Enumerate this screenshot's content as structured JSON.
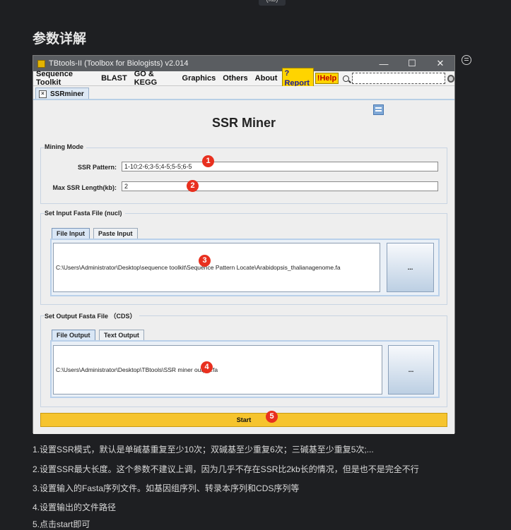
{
  "top_chip": "(kb)",
  "section_heading": "参数详解",
  "window": {
    "title": "TBtools-II (Toolbox for Biologists) v2.014",
    "controls": {
      "minimize": "—",
      "maximize": "☐",
      "close": "✕"
    }
  },
  "menu": {
    "items": [
      "Sequence Toolkit",
      "BLAST",
      "GO & KEGG",
      "Graphics",
      "Others",
      "About"
    ],
    "report_label": "?Report",
    "help_label": "!Help",
    "search_value": ""
  },
  "tab": {
    "close": "×",
    "label": "SSRminer"
  },
  "app": {
    "title": "SSR Miner",
    "mining_mode": {
      "label": "Mining Mode",
      "ssr_pattern_label": "SSR Pattern:",
      "ssr_pattern_value": "1-10;2-6;3-5;4-5;5-5;6-5",
      "max_len_label": "Max SSR Length(kb):",
      "max_len_value": "2"
    },
    "input": {
      "label": "Set Input Fasta File (nucl)",
      "tabs": [
        "File Input",
        "Paste Input"
      ],
      "path": "C:\\Users\\Administrator\\Desktop\\sequence toolkit\\Sequence Pattern Locate\\Arabidopsis_thalianagenome.fa",
      "browse_label": "..."
    },
    "output": {
      "label": "Set Output Fasta File （CDS）",
      "tabs": [
        "File Output",
        "Text Output"
      ],
      "path": "C:\\Users\\Administrator\\Desktop\\TBtools\\SSR miner output.fa",
      "browse_label": "..."
    },
    "start_label": "Start"
  },
  "markers": [
    "1",
    "2",
    "3",
    "4",
    "5"
  ],
  "notes": [
    "1.设置SSR模式，默认是单碱基重复至少10次；双碱基至少重复6次；三碱基至少重复5次;...",
    "2.设置SSR最大长度。这个参数不建议上调，因为几乎不存在SSR比2kb长的情况，但是也不是完全不行",
    "3.设置输入的Fasta序列文件。如基因组序列、转录本序列和CDS序列等",
    "4.设置输出的文件路径",
    "5.点击start即可"
  ]
}
